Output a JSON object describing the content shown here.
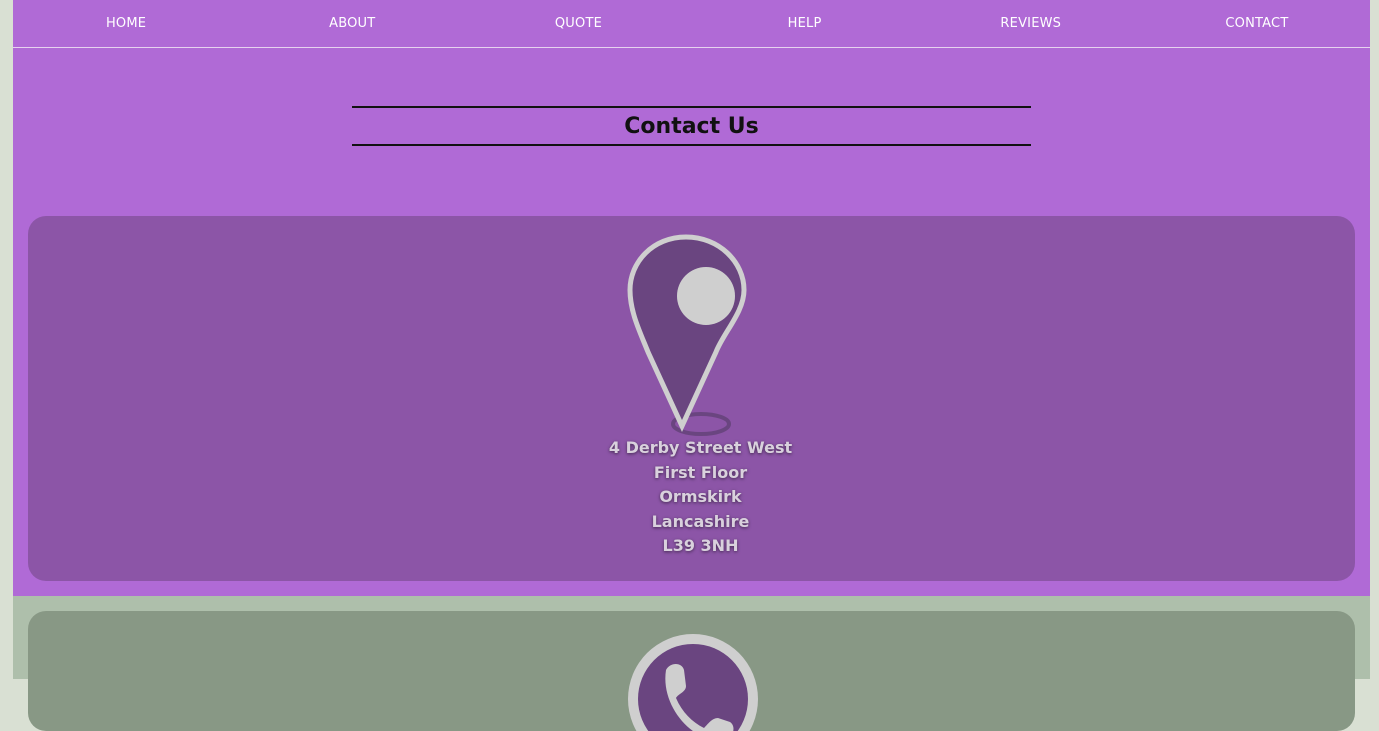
{
  "nav": {
    "items": [
      "HOME",
      "ABOUT",
      "QUOTE",
      "HELP",
      "REVIEWS",
      "CONTACT"
    ]
  },
  "page_title": "Contact Us",
  "address_card": {
    "icon": "map-pin-icon",
    "lines": [
      "4 Derby Street West",
      "First Floor",
      "Ormskirk",
      "Lancashire",
      "L39 3NH"
    ]
  },
  "second_card": {
    "icon": "phone-icon"
  },
  "colors": {
    "background": "#d9e0d3",
    "purple_section": "#b06ad6",
    "card_purple": "#8c55a7",
    "card_green": "#889885",
    "icon_dark": "#6a4580",
    "icon_light": "#cfcfcf"
  }
}
